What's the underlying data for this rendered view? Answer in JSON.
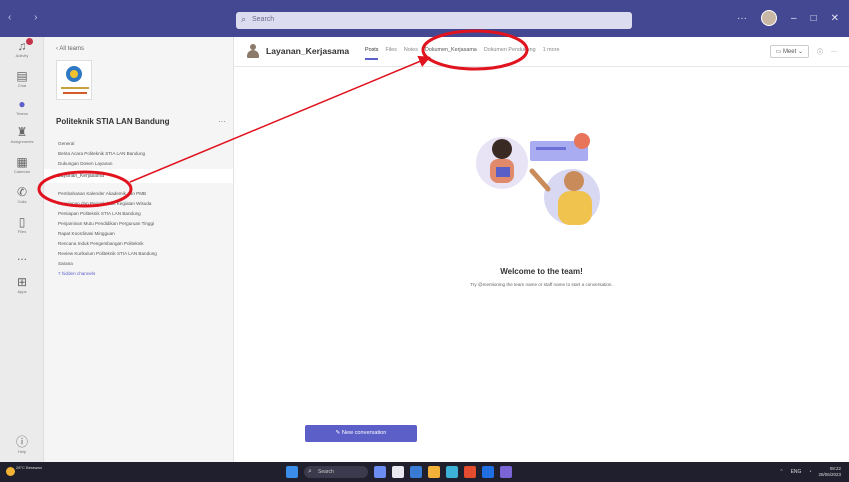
{
  "search": {
    "placeholder": "Search"
  },
  "rail": {
    "items": [
      {
        "label": "Activity",
        "icon": "bell-icon"
      },
      {
        "label": "Chat",
        "icon": "chat-icon"
      },
      {
        "label": "Teams",
        "icon": "teams-icon"
      },
      {
        "label": "Assignments",
        "icon": "assignments-icon"
      },
      {
        "label": "Calendar",
        "icon": "calendar-icon"
      },
      {
        "label": "Calls",
        "icon": "phone-icon"
      },
      {
        "label": "Files",
        "icon": "file-icon"
      },
      {
        "label": "...",
        "icon": "more-icon"
      },
      {
        "label": "Apps",
        "icon": "apps-icon"
      },
      {
        "label": "Help",
        "icon": "help-icon"
      }
    ]
  },
  "sidebar": {
    "back": "‹ All teams",
    "team_name": "Politeknik STIA LAN Bandung",
    "more": "···",
    "channels": [
      "General",
      "Berita Acara Politeknik STIA LAN Bandung",
      "Dukungan Dosen Layanan",
      "Layanan_Kerjasama",
      "Pembahasan Kalender Akademik dan PMB",
      "Penyiapan dan Pengelolaan Kegiatan Wisuda",
      "Persiapan Politeknik STIA LAN Bandung",
      "Penjaminan Mutu Pendidikan Perguruan Tinggi",
      "Rapat Koordinasi Mingguan",
      "Rencana Induk Pengembangan Politeknik",
      "Review Kurikulum Politeknik STIA LAN Bandung",
      "Sarana",
      "7 hidden channels"
    ]
  },
  "header": {
    "channel_title": "Layanan_Kerjasama",
    "tabs": [
      "Posts",
      "Files",
      "Notes",
      "Dokumen_Kerjasama",
      "Dokumen Pendukung",
      "1 more"
    ],
    "meet_label": "Meet"
  },
  "main": {
    "welcome_title": "Welcome to the team!",
    "welcome_sub": "Try @mentioning the team name or staff name to start a conversation.",
    "new_conversation": "New conversation"
  },
  "taskbar": {
    "weather": "28°C Berawan",
    "search": "Search",
    "tray": "ENG",
    "time": "08:22",
    "date": "28/06/2023"
  },
  "colors": {
    "titlebar": "#444791",
    "accent": "#5b5fc7",
    "annotation": "#e0131f"
  }
}
